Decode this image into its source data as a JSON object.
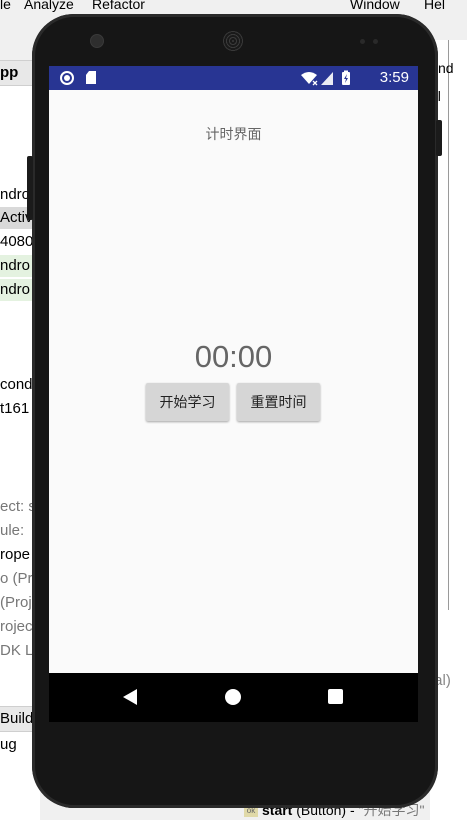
{
  "ide": {
    "menu": [
      "le",
      "Analyze",
      "Refactor",
      "Window",
      "Hel"
    ],
    "left_panel": {
      "project_tab": "pp",
      "rows": [
        "ndro",
        "Activ",
        "4080",
        "ndro",
        "ndro",
        "cond",
        "t161",
        "ect: s",
        "ule:",
        "rope",
        "o (Pro",
        "(Proj",
        "rojec",
        "DK L"
      ],
      "build_tab": "Build",
      "debug_tab": "ug"
    },
    "right_panel": {
      "top_label": "nd",
      "mid_label": "al",
      "bottom_label": "tal)"
    },
    "bottom_note": {
      "badge": "ok",
      "name": "start",
      "type": "(Button)",
      "separator": "-",
      "value": "\"开始学习\""
    }
  },
  "device": {
    "status_bar": {
      "time": "3:59",
      "color": "#283593"
    },
    "app": {
      "title": "计时界面",
      "timer": "00:00",
      "start_button": "开始学习",
      "reset_button": "重置时间"
    },
    "nav_bar": {
      "icons": [
        "back-icon",
        "home-icon",
        "recent-apps-icon"
      ]
    }
  }
}
